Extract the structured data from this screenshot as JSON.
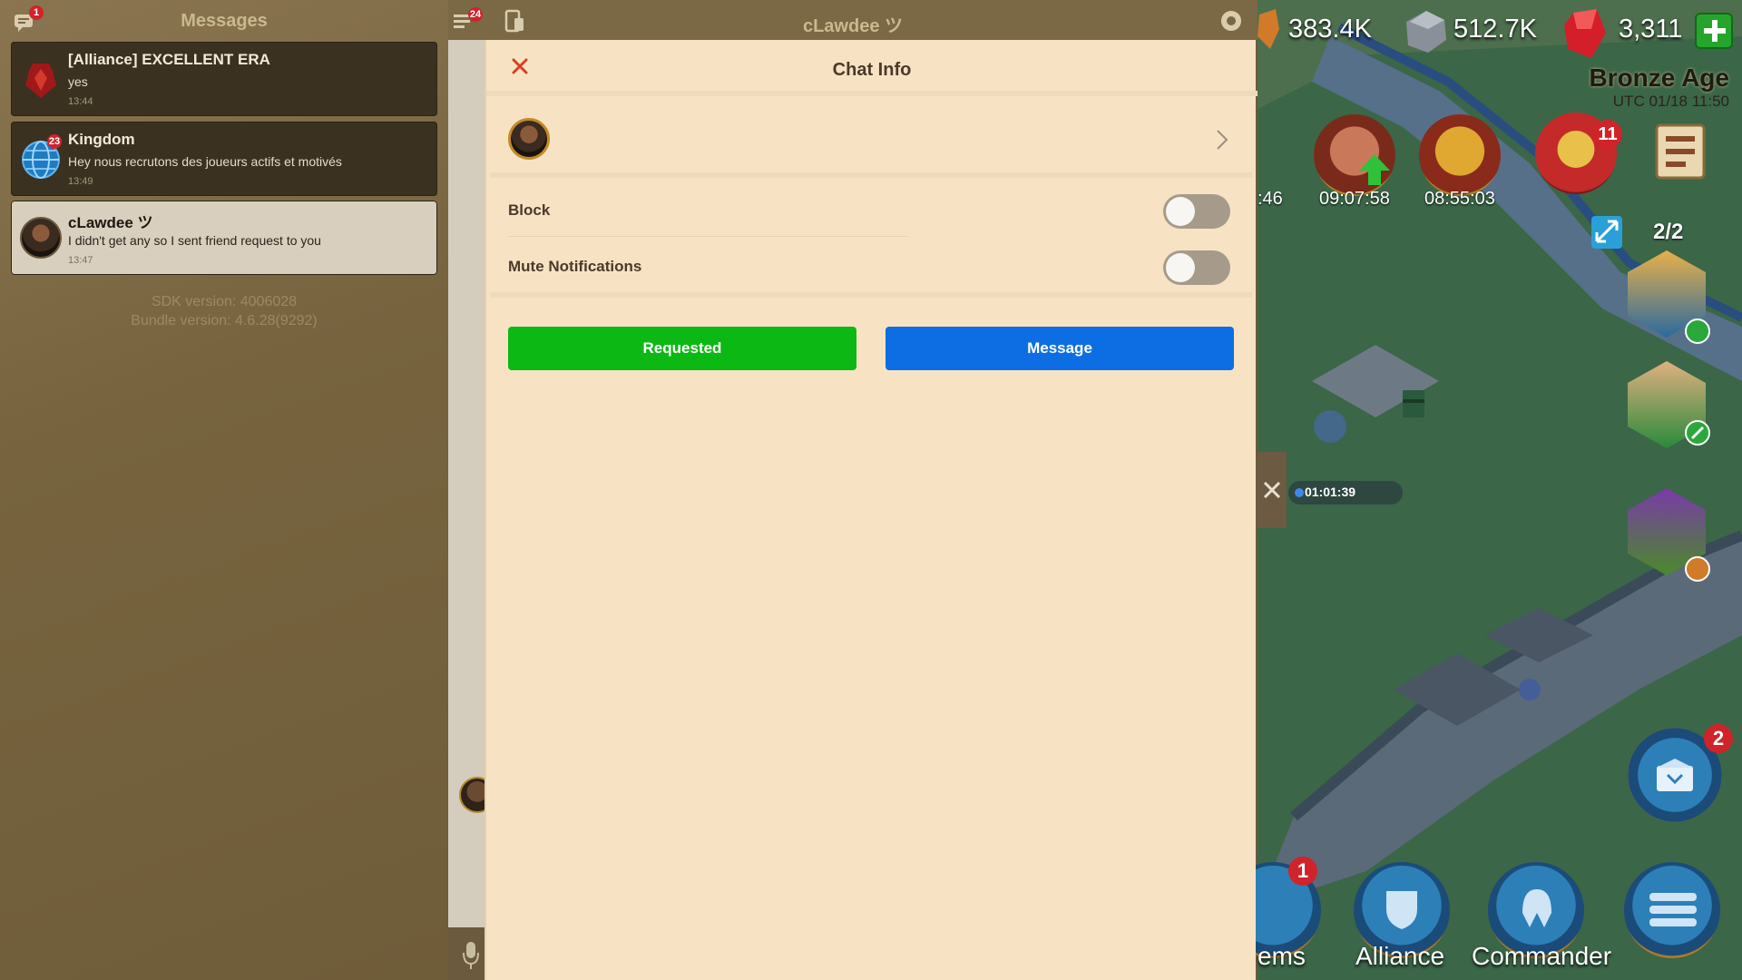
{
  "messages_panel": {
    "title": "Messages",
    "mail_badge": "1",
    "conversations": [
      {
        "name": "[Alliance] EXCELLENT ERA",
        "last_message": "yes",
        "time": "13:44",
        "badge": ""
      },
      {
        "name": "Kingdom",
        "last_message": "Hey nous recrutons des joueurs actifs et motivés",
        "time": "13:49",
        "badge": "23"
      },
      {
        "name": "cLawdee ツ",
        "last_message": "I didn't get any so I sent friend request to you",
        "time": "13:47",
        "badge": ""
      }
    ],
    "sdk_version": "SDK version: 4006028",
    "bundle_version": "Bundle version: 4.6.28(9292)"
  },
  "chat_header": {
    "title": "cLawdee ツ",
    "list_badge": "24"
  },
  "chat_info": {
    "title": "Chat Info",
    "block_label": "Block",
    "block_on": false,
    "mute_label": "Mute Notifications",
    "mute_on": false,
    "requested_label": "Requested",
    "message_label": "Message"
  },
  "game": {
    "resources": {
      "stone": "383.4K",
      "ore": "512.7K",
      "gems": "3,311"
    },
    "age_title": "Bronze Age",
    "utc_time": "UTC 01/18 11:50",
    "timers": {
      "left_partial": ":46",
      "hero1": "09:07:58",
      "hero2": "08:55:03",
      "march": "01:01:39"
    },
    "event_badge": "11",
    "army_count": "2/2",
    "mail_badge": "2",
    "items_badge": "1",
    "bottom_nav": {
      "items_partial": "ems",
      "alliance": "Alliance",
      "commander": "Commander"
    },
    "colors": {
      "requested_green": "#0cb914",
      "message_blue": "#0d6ee3",
      "modal_bg": "#f7e3c4",
      "badge_red": "#d0232a"
    }
  }
}
